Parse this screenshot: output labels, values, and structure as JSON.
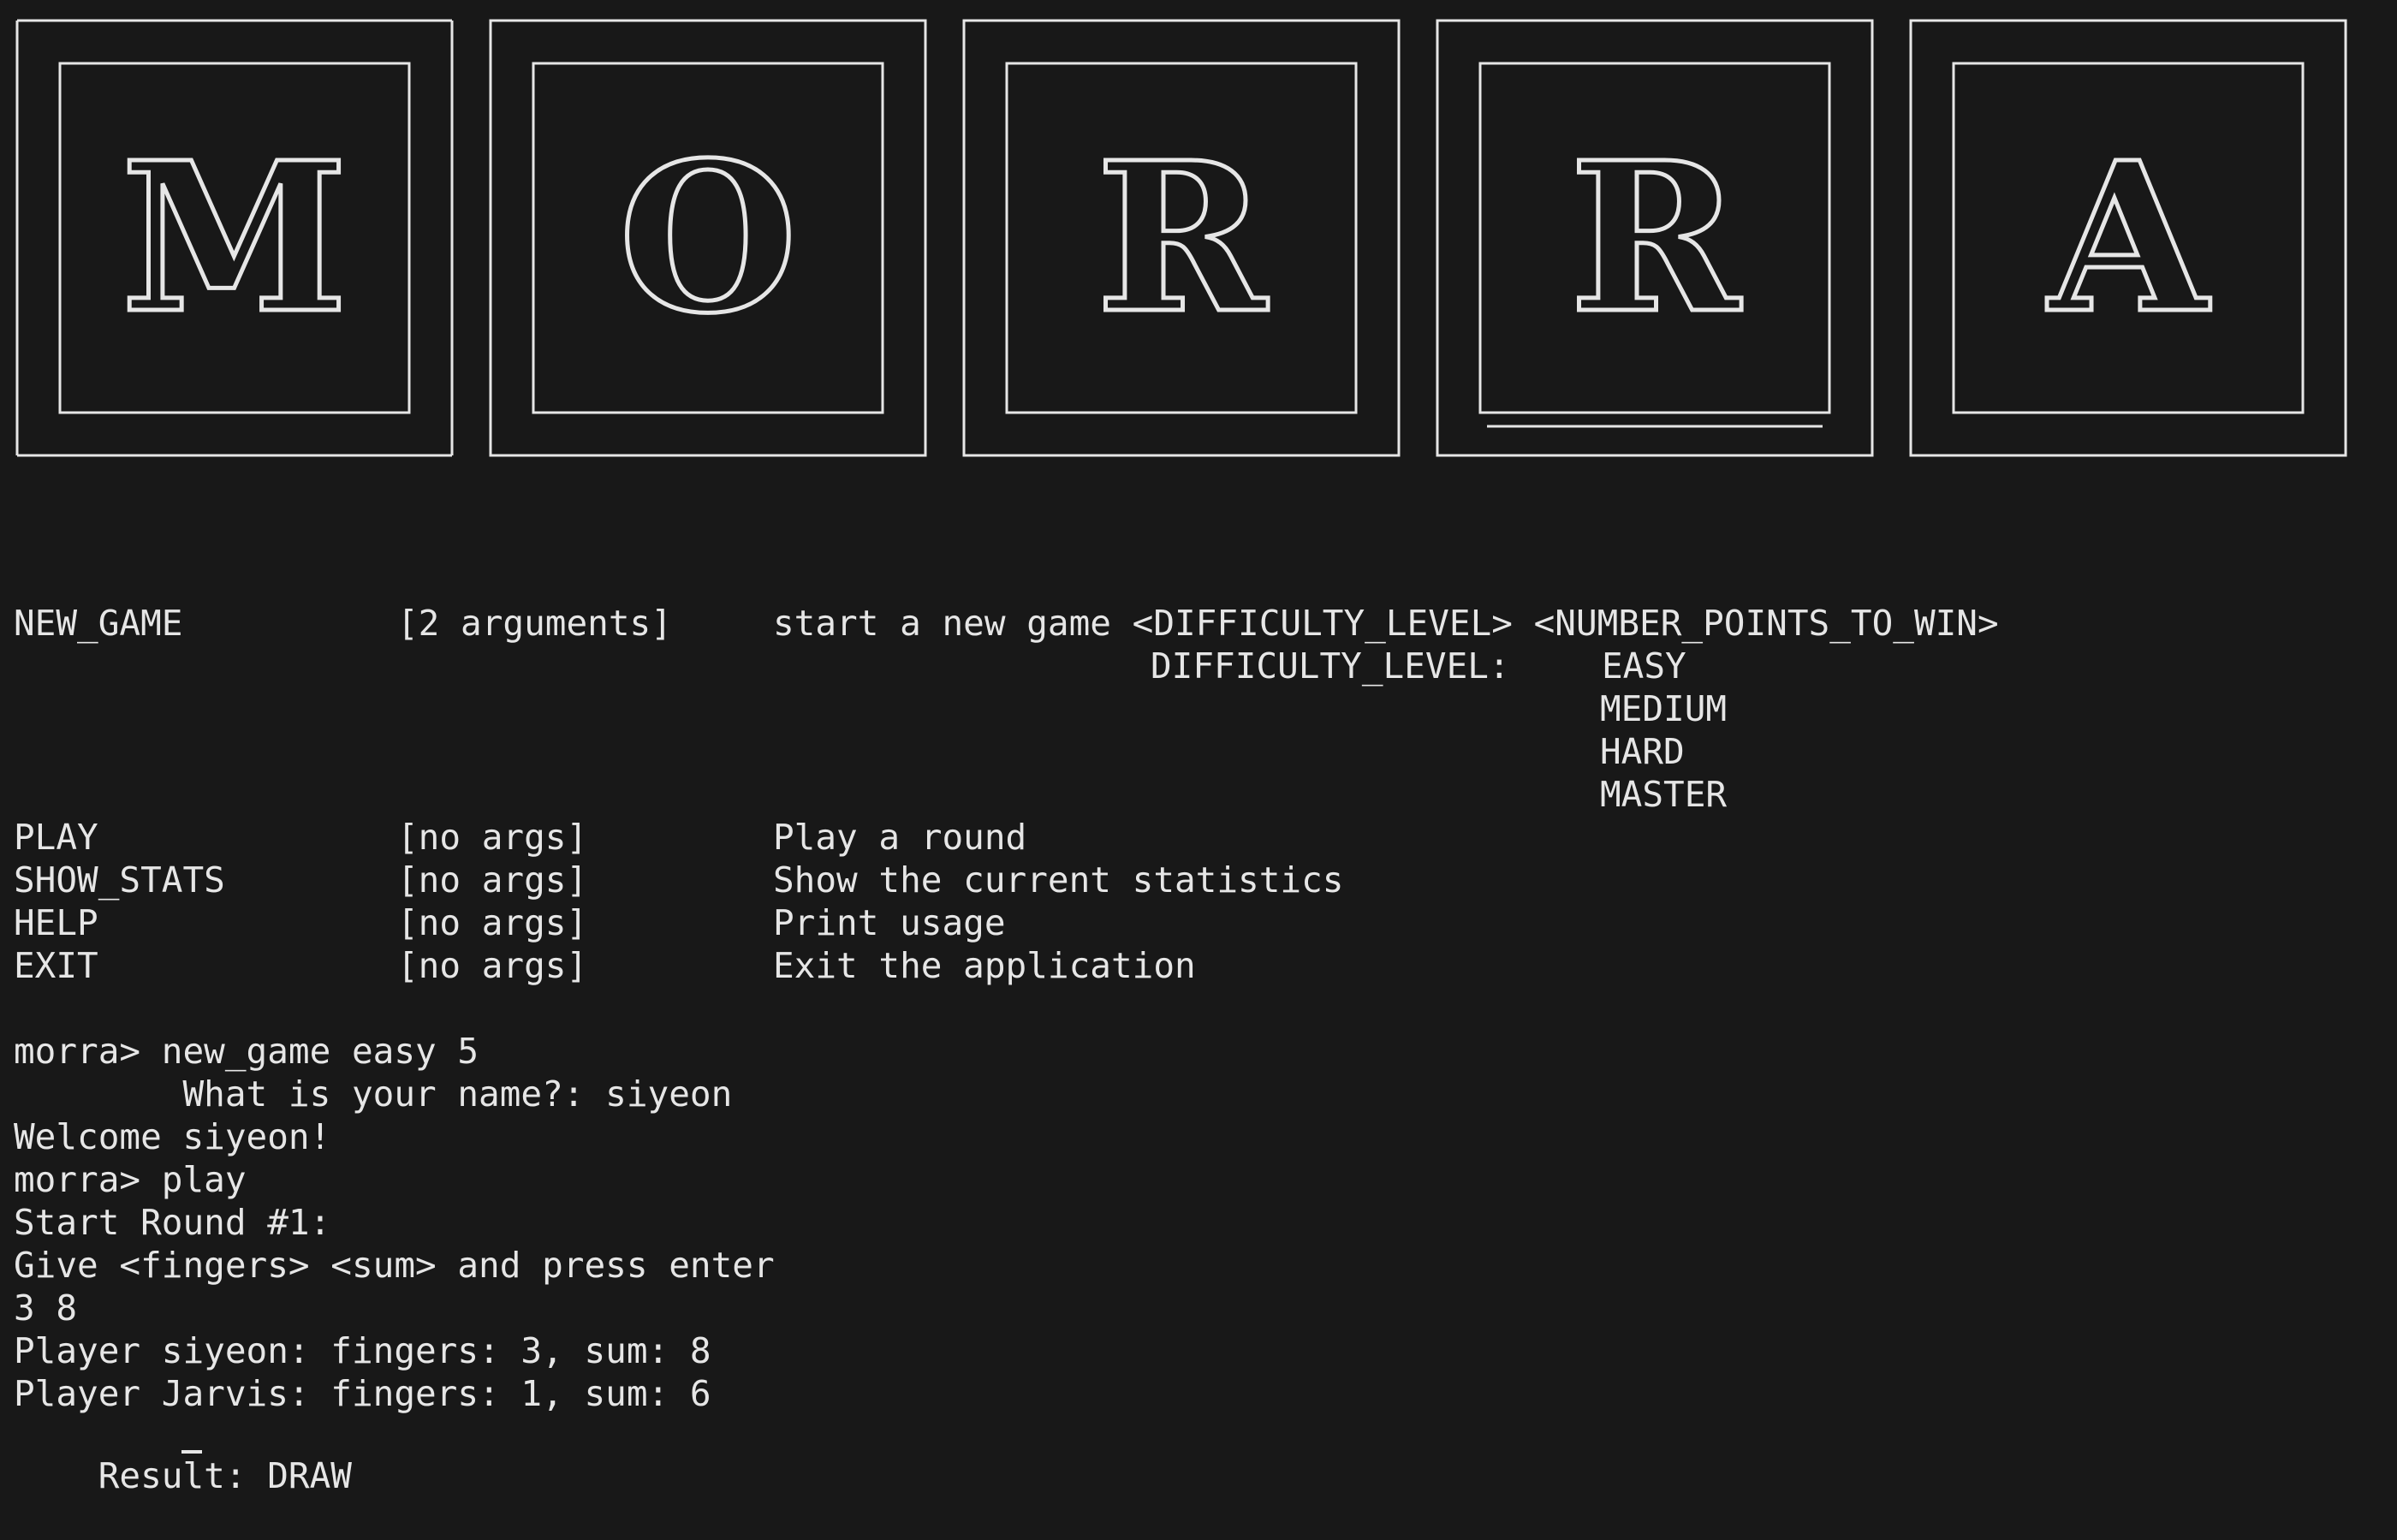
{
  "banner": {
    "letters": [
      "M",
      "O",
      "R",
      "R",
      "A"
    ]
  },
  "help": {
    "new_game": {
      "command": "NEW_GAME",
      "args": "[2 arguments]",
      "description": "start a new game <DIFFICULTY_LEVEL> <NUMBER_POINTS_TO_WIN>",
      "difficulty_label": "DIFFICULTY_LEVEL:",
      "levels": [
        "EASY",
        "MEDIUM",
        "HARD",
        "MASTER"
      ]
    },
    "commands": [
      {
        "command": "PLAY",
        "args": "[no args]",
        "description": "Play a round"
      },
      {
        "command": "SHOW_STATS",
        "args": "[no args]",
        "description": "Show the current statistics"
      },
      {
        "command": "HELP",
        "args": "[no args]",
        "description": "Print usage"
      },
      {
        "command": "EXIT",
        "args": "[no args]",
        "description": "Exit the application"
      }
    ]
  },
  "session": {
    "lines": [
      "morra> new_game easy 5",
      "        What is your name?: siyeon",
      "Welcome siyeon!",
      "morra> play",
      "Start Round #1:",
      "Give <fingers> <sum> and press enter",
      "3 8",
      "Player siyeon: fingers: 3, sum: 8",
      "Player Jarvis: fingers: 1, sum: 6",
      "Result: DRAW"
    ]
  },
  "colors": {
    "background": "#181818",
    "text": "#e6e6e6"
  }
}
